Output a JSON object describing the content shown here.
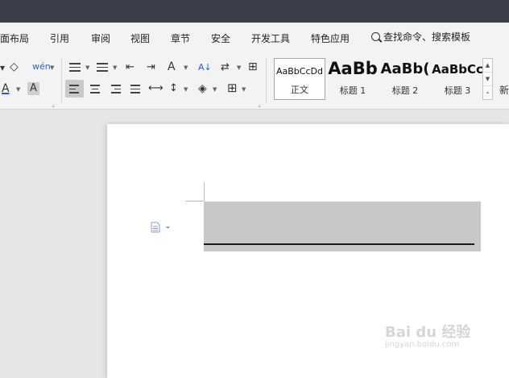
{
  "menu": {
    "items": [
      "面布局",
      "引用",
      "审阅",
      "视图",
      "章节",
      "安全",
      "开发工具",
      "特色应用"
    ],
    "search_label": "查找命令、搜索模板"
  },
  "toolbar": {
    "phonetic_glyph": "wén",
    "font_color_glyph": "A",
    "highlight_glyph": "A",
    "sort_glyph": "A↓"
  },
  "styles": {
    "items": [
      {
        "sample": "AaBbCcDd",
        "name": "正文"
      },
      {
        "sample": "AaBb",
        "name": "标题 1"
      },
      {
        "sample": "AaBb(",
        "name": "标题 2"
      },
      {
        "sample": "AaBbCc",
        "name": "标题 3"
      }
    ],
    "more_label": "新"
  },
  "colors": {
    "titlebar": "#3b3e48",
    "font_color_underline": "#2b5fd9"
  },
  "watermark": {
    "brand": "Bai du 经验",
    "url": "jingyan.baidu.com"
  }
}
